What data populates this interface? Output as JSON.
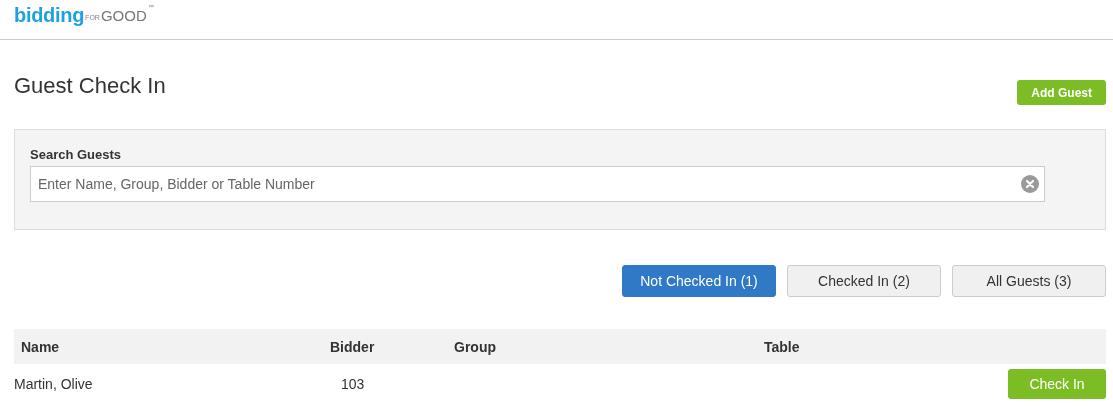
{
  "logo": {
    "brand_first": "bidding",
    "brand_for": "FOR",
    "brand_last": "GOOD",
    "trademark": "™"
  },
  "page_title": "Guest Check In",
  "add_button": "Add Guest",
  "search": {
    "label": "Search Guests",
    "placeholder": "Enter Name, Group, Bidder or Table Number"
  },
  "tabs": [
    {
      "label": "Not Checked In (1)",
      "selected": true
    },
    {
      "label": "Checked In (2)",
      "selected": false
    },
    {
      "label": "All Guests (3)",
      "selected": false
    }
  ],
  "table": {
    "columns": [
      "Name",
      "Bidder",
      "Group",
      "Table"
    ],
    "rows": [
      {
        "name": "Martin, Olive",
        "bidder": "103",
        "action": "Check In"
      }
    ]
  }
}
